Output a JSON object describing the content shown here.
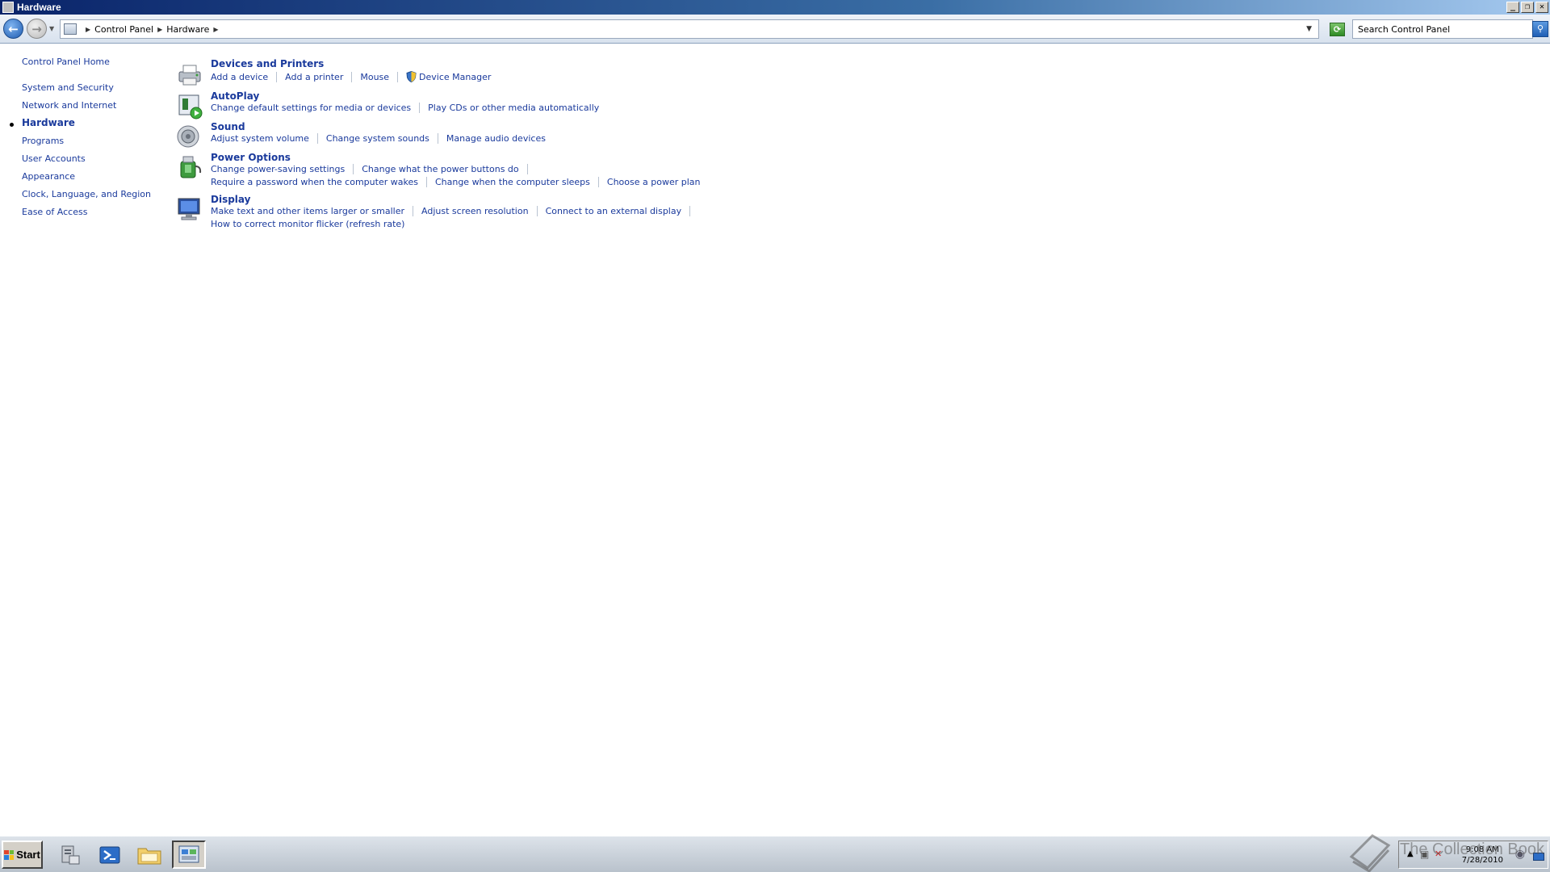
{
  "window": {
    "title": "Hardware",
    "minimize_icon": "minimize-icon",
    "restore_icon": "restore-icon",
    "close_icon": "close-icon"
  },
  "address_bar": {
    "breadcrumbs": [
      "Control Panel",
      "Hardware"
    ],
    "search_placeholder": "Search Control Panel"
  },
  "left_nav": {
    "items": [
      {
        "label": "Control Panel Home",
        "current": false
      },
      {
        "label": "System and Security",
        "current": false
      },
      {
        "label": "Network and Internet",
        "current": false
      },
      {
        "label": "Hardware",
        "current": true
      },
      {
        "label": "Programs",
        "current": false
      },
      {
        "label": "User Accounts",
        "current": false
      },
      {
        "label": "Appearance",
        "current": false
      },
      {
        "label": "Clock, Language, and Region",
        "current": false
      },
      {
        "label": "Ease of Access",
        "current": false
      }
    ]
  },
  "categories": [
    {
      "title": "Devices and Printers",
      "icon": "printer-icon",
      "rows": [
        [
          "Add a device",
          "Add a printer",
          "Mouse",
          "Device Manager"
        ]
      ]
    },
    {
      "title": "AutoPlay",
      "icon": "autoplay-icon",
      "rows": [
        [
          "Change default settings for media or devices",
          "Play CDs or other media automatically"
        ]
      ]
    },
    {
      "title": "Sound",
      "icon": "speaker-icon",
      "rows": [
        [
          "Adjust system volume",
          "Change system sounds",
          "Manage audio devices"
        ]
      ]
    },
    {
      "title": "Power Options",
      "icon": "power-options-icon",
      "rows": [
        [
          "Change power-saving settings",
          "Change what the power buttons do"
        ],
        [
          "Require a password when the computer wakes",
          "Change when the computer sleeps",
          "Choose a power plan"
        ]
      ]
    },
    {
      "title": "Display",
      "icon": "monitor-icon",
      "rows": [
        [
          "Make text and other items larger or smaller",
          "Adjust screen resolution",
          "Connect to an external display"
        ],
        [
          "How to correct monitor flicker (refresh rate)"
        ]
      ]
    }
  ],
  "taskbar": {
    "start_label": "Start",
    "clock_time": "9:08 AM",
    "clock_date": "7/28/2010",
    "watermark": "The Collection Book"
  }
}
